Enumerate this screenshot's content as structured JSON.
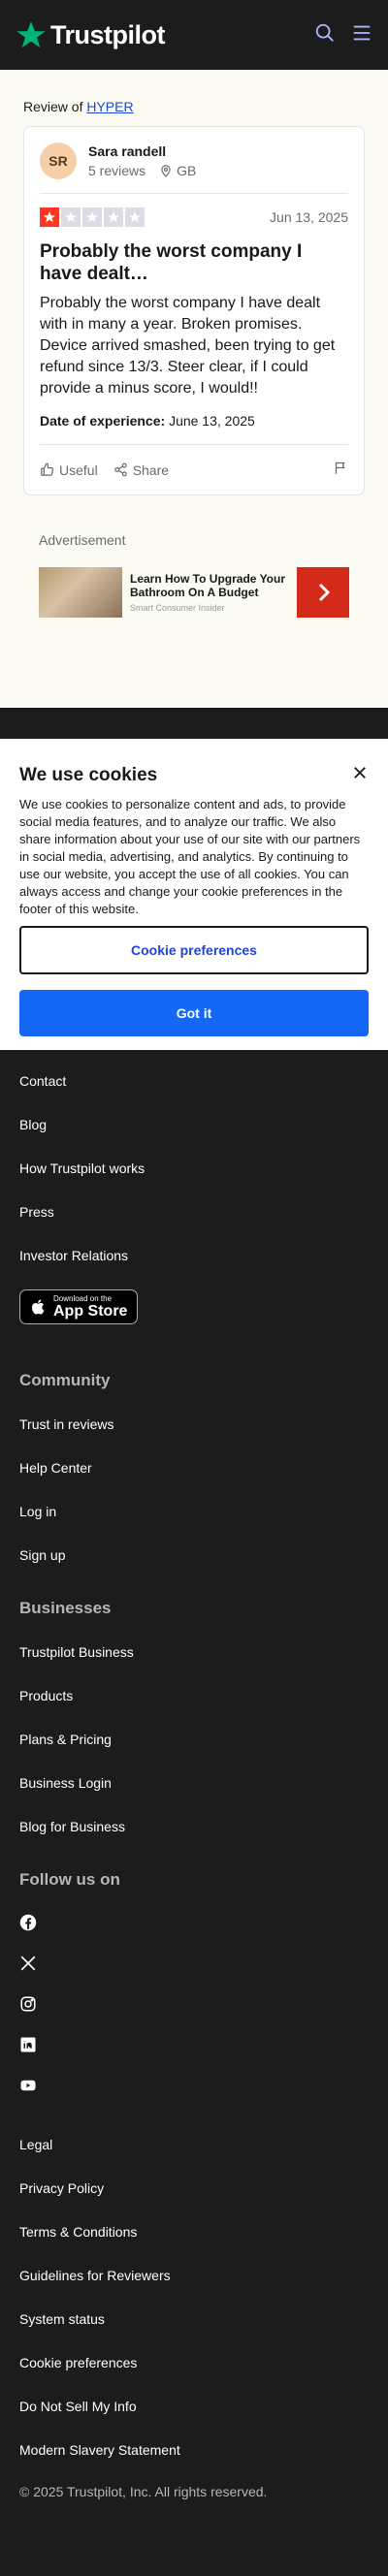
{
  "header": {
    "logo_text": "Trustpilot",
    "brand_color": "#00b67a"
  },
  "review_of": {
    "prefix": "Review of",
    "company": "HYPER"
  },
  "review": {
    "avatar_initials": "SR",
    "name": "Sara randell",
    "review_count": "5 reviews",
    "country": "GB",
    "rating": 1,
    "date": "Jun 13, 2025",
    "title": "Probably the worst company I have dealt…",
    "body": "Probably the worst company I have dealt with in many a year. Broken promises. Device arrived smashed, been trying to get refund since 13/3. Steer clear, if I could provide a minus score, I would!!",
    "experience_label": "Date of experience:",
    "experience_date": "June 13, 2025",
    "useful_label": "Useful",
    "share_label": "Share"
  },
  "ad": {
    "label": "Advertisement",
    "title": "Learn How To Upgrade Your Bathroom On A Budget",
    "source": "Smart Consumer Insider"
  },
  "cookie": {
    "title": "We use cookies",
    "text": "We use cookies to personalize content and ads, to provide social media features, and to analyze our traffic. We also share information about your use of our site with our partners in social media, advertising, and analytics. By continuing to use our website, you accept the use of all cookies. You can always access and change your cookie preferences in the footer of this website.",
    "preferences_label": "Cookie preferences",
    "accept_label": "Got it"
  },
  "footer": {
    "links_top": [
      "Contact",
      "Blog",
      "How Trustpilot works",
      "Press",
      "Investor Relations"
    ],
    "appstore": {
      "small": "Download on the",
      "big": "App Store"
    },
    "community_title": "Community",
    "community_links": [
      "Trust in reviews",
      "Help Center",
      "Log in",
      "Sign up"
    ],
    "business_title": "Businesses",
    "business_links": [
      "Trustpilot Business",
      "Products",
      "Plans & Pricing",
      "Business Login",
      "Blog for Business"
    ],
    "follow_title": "Follow us on",
    "social": [
      "facebook-icon",
      "x-icon",
      "instagram-icon",
      "linkedin-icon",
      "youtube-icon"
    ],
    "legal_links": [
      "Legal",
      "Privacy Policy",
      "Terms & Conditions",
      "Guidelines for Reviewers",
      "System status",
      "Cookie preferences",
      "Do Not Sell My Info",
      "Modern Slavery Statement"
    ],
    "copyright": "© 2025 Trustpilot, Inc. All rights reserved."
  }
}
